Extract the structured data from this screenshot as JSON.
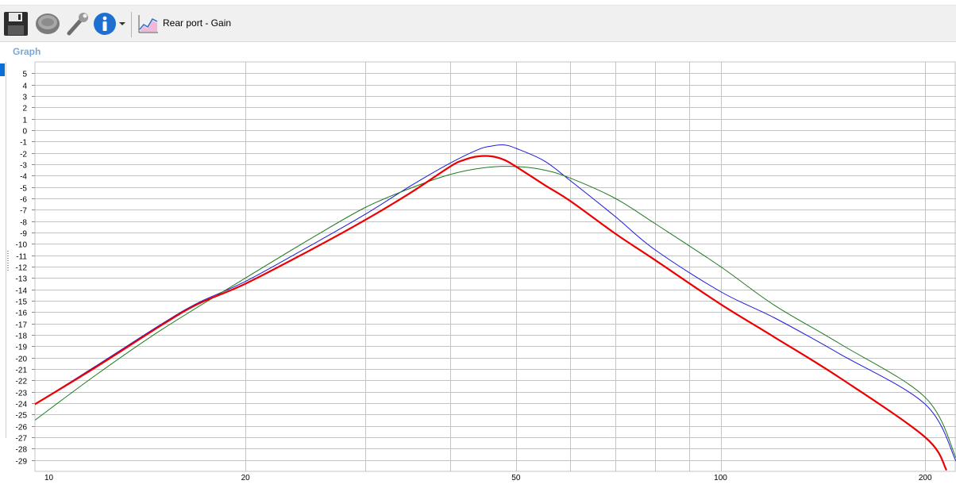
{
  "toolbar": {
    "save_icon": "floppy-disk-icon",
    "speaker_icon": "speaker-icon",
    "wrench_icon": "wrench-icon",
    "info_icon": "info-icon",
    "dropdown_icon": "chevron-down-icon",
    "graph_icon": "graph-icon",
    "graph_title": "Rear port - Gain"
  },
  "panel": {
    "label": "Graph"
  },
  "chart_data": {
    "type": "line",
    "x_scale": "log",
    "xlim": [
      9.8,
      222
    ],
    "ylim": [
      -30,
      6
    ],
    "x_ticks": [
      10,
      20,
      50,
      100,
      200
    ],
    "x_gridlines": [
      20,
      30,
      40,
      50,
      60,
      70,
      80,
      90,
      100,
      200
    ],
    "y_ticks": [
      5,
      4,
      3,
      2,
      1,
      0,
      -1,
      -2,
      -3,
      -4,
      -5,
      -6,
      -7,
      -8,
      -9,
      -10,
      -11,
      -12,
      -13,
      -14,
      -15,
      -16,
      -17,
      -18,
      -19,
      -20,
      -21,
      -22,
      -23,
      -24,
      -25,
      -26,
      -27,
      -28,
      -29
    ],
    "grid": true,
    "colors": {
      "red": "#ee0000",
      "blue": "#1a1adc",
      "green": "#1e7a1e",
      "grid": "#c4c4c4",
      "minor_grid": "#dcdcdc"
    },
    "series": [
      {
        "color": "#1a1adc",
        "width": 1,
        "x": [
          9.8,
          12,
          15,
          17,
          20,
          25,
          30,
          35,
          40,
          44,
          46,
          48,
          50,
          55,
          60,
          70,
          80,
          100,
          120,
          150,
          200,
          222
        ],
        "y": [
          -24.1,
          -20.8,
          -17.1,
          -15.2,
          -13.3,
          -10.1,
          -7.4,
          -4.9,
          -2.9,
          -1.7,
          -1.4,
          -1.3,
          -1.6,
          -2.7,
          -4.4,
          -7.6,
          -10.5,
          -14.2,
          -16.5,
          -19.7,
          -24.1,
          -29.1
        ]
      },
      {
        "color": "#1e7a1e",
        "width": 1,
        "x": [
          9.8,
          12,
          15,
          20,
          25,
          30,
          35,
          40,
          45,
          50,
          55,
          60,
          70,
          80,
          100,
          120,
          150,
          200,
          222
        ],
        "y": [
          -25.5,
          -21.6,
          -17.6,
          -13.0,
          -9.5,
          -6.8,
          -5.1,
          -3.9,
          -3.3,
          -3.2,
          -3.5,
          -4.2,
          -6.0,
          -8.2,
          -12.0,
          -15.4,
          -18.8,
          -23.5,
          -28.8
        ]
      },
      {
        "color": "#ee0000",
        "width": 2.2,
        "x": [
          9.8,
          12,
          15,
          17,
          20,
          25,
          30,
          35,
          40,
          42,
          44,
          46,
          48,
          50,
          55,
          60,
          70,
          80,
          100,
          120,
          150,
          200,
          215
        ],
        "y": [
          -24.1,
          -20.9,
          -17.2,
          -15.3,
          -13.5,
          -10.5,
          -7.9,
          -5.5,
          -3.2,
          -2.6,
          -2.3,
          -2.3,
          -2.6,
          -3.2,
          -4.8,
          -6.2,
          -9.1,
          -11.4,
          -15.3,
          -18.2,
          -21.8,
          -27.0,
          -29.9
        ]
      }
    ]
  }
}
